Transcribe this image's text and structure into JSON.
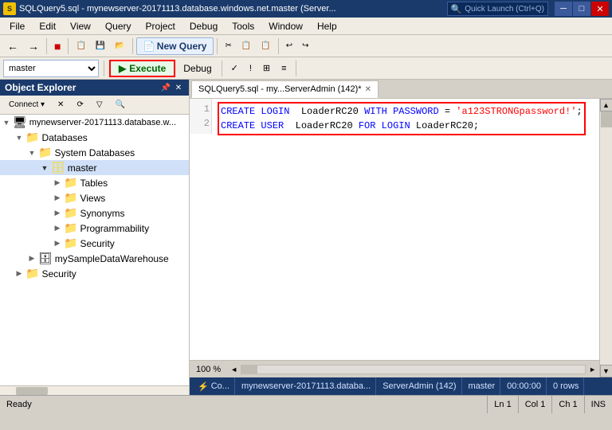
{
  "titlebar": {
    "icon": "S",
    "title": "SQLQuery5.sql - mynewserver-20171113.database.windows.net.master (Server...",
    "quick_launch_placeholder": "Quick Launch (Ctrl+Q)",
    "min": "─",
    "max": "□",
    "close": "✕"
  },
  "menubar": {
    "items": [
      "File",
      "Edit",
      "View",
      "Query",
      "Project",
      "Debug",
      "Tools",
      "Window",
      "Help"
    ]
  },
  "toolbar1": {
    "new_query_label": "New Query",
    "buttons": [
      "←",
      "→",
      "⬛",
      "📋",
      "💾",
      "📂",
      "✂",
      "📋",
      "🗑",
      "↩",
      "↪"
    ]
  },
  "toolbar2": {
    "execute_label": "Execute",
    "debug_label": "Debug",
    "db_options": [
      "master"
    ],
    "db_selected": "master"
  },
  "object_explorer": {
    "title": "Object Explorer",
    "connect_label": "Connect ▾",
    "tree": [
      {
        "id": "server",
        "label": "mynewserver-20171113.database.w...",
        "icon": "🖥",
        "level": 0,
        "expanded": true,
        "has_children": true
      },
      {
        "id": "databases",
        "label": "Databases",
        "icon": "📁",
        "level": 1,
        "expanded": true,
        "has_children": true
      },
      {
        "id": "system_db",
        "label": "System Databases",
        "icon": "📁",
        "level": 2,
        "expanded": true,
        "has_children": true
      },
      {
        "id": "master",
        "label": "master",
        "icon": "🗄",
        "level": 3,
        "expanded": true,
        "has_children": true,
        "selected": true
      },
      {
        "id": "tables",
        "label": "Tables",
        "icon": "📁",
        "level": 4,
        "expanded": false,
        "has_children": true
      },
      {
        "id": "views",
        "label": "Views",
        "icon": "📁",
        "level": 4,
        "expanded": false,
        "has_children": true
      },
      {
        "id": "synonyms",
        "label": "Synonyms",
        "icon": "📁",
        "level": 4,
        "expanded": false,
        "has_children": true
      },
      {
        "id": "programmability",
        "label": "Programmability",
        "icon": "📁",
        "level": 4,
        "expanded": false,
        "has_children": true
      },
      {
        "id": "security_master",
        "label": "Security",
        "icon": "📁",
        "level": 4,
        "expanded": false,
        "has_children": true
      },
      {
        "id": "mysample",
        "label": "mySampleDataWarehouse",
        "icon": "🗄",
        "level": 2,
        "expanded": false,
        "has_children": true
      },
      {
        "id": "security_root",
        "label": "Security",
        "icon": "📁",
        "level": 1,
        "expanded": false,
        "has_children": true
      }
    ]
  },
  "query_tab": {
    "label": "SQLQuery5.sql - my...ServerAdmin (142)*",
    "close": "✕"
  },
  "sql_code": {
    "line1": "CREATE LOGIN LoaderRC20 WITH PASSWORD = 'a123STRONGpassword!';",
    "line2": "CREATE USER LoaderRC20 FOR LOGIN LoaderRC20;",
    "line1_parts": {
      "kw1": "CREATE",
      "kw2": "LOGIN",
      "id1": "LoaderRC20",
      "kw3": "WITH",
      "kw4": "PASSWORD",
      "op": "=",
      "str": "'a123STRONGpassword!'"
    },
    "line2_parts": {
      "kw1": "CREATE",
      "kw2": "USER",
      "id1": "LoaderRC20",
      "kw3": "FOR",
      "kw4": "LOGIN",
      "id2": "LoaderRC20"
    }
  },
  "editor_status": {
    "zoom": "100 %",
    "connection_icon": "🔌",
    "connection_label": "Co...",
    "server": "mynewserver-20171113.databa...",
    "user": "ServerAdmin (142)",
    "db": "master",
    "time": "00:00:00",
    "rows": "0 rows"
  },
  "status_bar": {
    "ready": "Ready",
    "ln": "Ln 1",
    "col": "Col 1",
    "ch": "Ch 1",
    "ins": "INS"
  }
}
